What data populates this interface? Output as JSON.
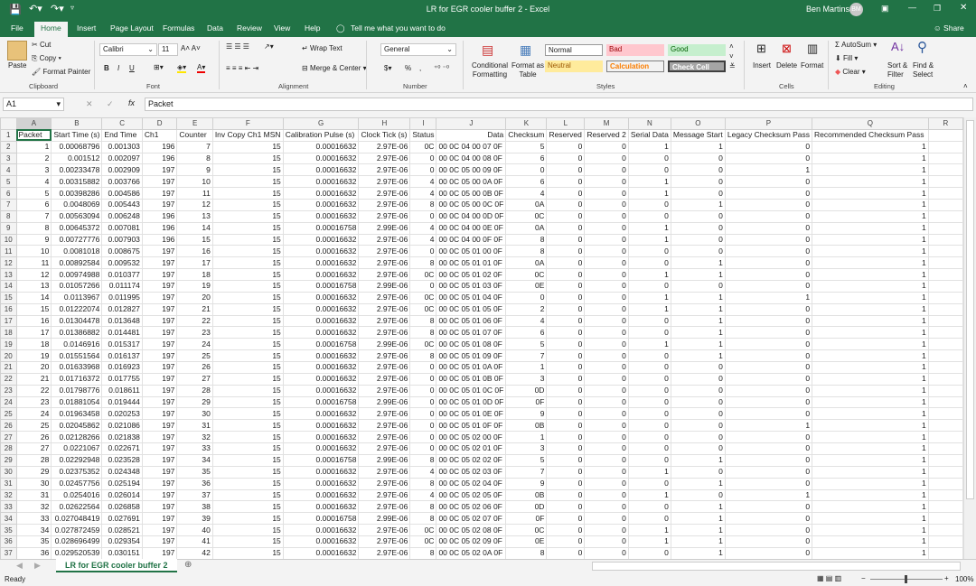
{
  "title": "LR for EGR cooler buffer 2  -  Excel",
  "user": {
    "name": "Ben Martins",
    "initials": "BM"
  },
  "share": "Share",
  "tabs": [
    "File",
    "Home",
    "Insert",
    "Page Layout",
    "Formulas",
    "Data",
    "Review",
    "View",
    "Help"
  ],
  "tell_me": "Tell me what you want to do",
  "ribbon": {
    "clipboard": {
      "paste": "Paste",
      "cut": "Cut",
      "copy": "Copy",
      "format_painter": "Format Painter",
      "label": "Clipboard"
    },
    "font": {
      "name": "Calibri",
      "size": "11",
      "bold": "B",
      "italic": "I",
      "underline": "U",
      "label": "Font"
    },
    "alignment": {
      "wrap": "Wrap Text",
      "merge": "Merge & Center",
      "label": "Alignment"
    },
    "number": {
      "format": "General",
      "percent": "%",
      "comma": ",",
      "label": "Number"
    },
    "styles": {
      "conditional": "Conditional Formatting",
      "format_table": "Format as Table",
      "normal": "Normal",
      "bad": "Bad",
      "good": "Good",
      "neutral": "Neutral",
      "calculation": "Calculation",
      "check": "Check Cell",
      "label": "Styles"
    },
    "cells": {
      "insert": "Insert",
      "delete": "Delete",
      "format": "Format",
      "label": "Cells"
    },
    "editing": {
      "autosum": "AutoSum",
      "fill": "Fill",
      "clear": "Clear",
      "sort": "Sort & Filter",
      "find": "Find & Select",
      "label": "Editing"
    }
  },
  "formula_bar": {
    "name_box": "A1",
    "content": "Packet"
  },
  "columns": [
    "A",
    "B",
    "C",
    "D",
    "E",
    "F",
    "G",
    "H",
    "I",
    "J",
    "K",
    "L",
    "M",
    "N",
    "O",
    "P",
    "Q",
    "R"
  ],
  "headers": [
    "Packet",
    "Start Time (s)",
    "End Time",
    "Ch1",
    "Counter",
    "Inv Copy Ch1 MSN",
    "Calibration Pulse (s)",
    "Clock Tick (s)",
    "Status",
    "Data",
    "Checksum",
    "Reserved",
    "Reserved 2",
    "Serial Data",
    "Message Start",
    "Legacy Checksum Pass",
    "Recommended Checksum Pass"
  ],
  "rows": [
    [
      "1",
      "0.00068796",
      "0.001303",
      "196",
      "7",
      "15",
      "0.00016632",
      "2.97E-06",
      "0C",
      "00 0C 04 00 07 0F",
      "5",
      "0",
      "0",
      "1",
      "1",
      "0",
      "1"
    ],
    [
      "2",
      "0.001512",
      "0.002097",
      "196",
      "8",
      "15",
      "0.00016632",
      "2.97E-06",
      "0",
      "00 0C 04 00 08 0F",
      "6",
      "0",
      "0",
      "0",
      "0",
      "0",
      "1"
    ],
    [
      "3",
      "0.00233478",
      "0.002909",
      "197",
      "9",
      "15",
      "0.00016632",
      "2.97E-06",
      "0",
      "00 0C 05 00 09 0F",
      "0",
      "0",
      "0",
      "0",
      "0",
      "1",
      "1"
    ],
    [
      "4",
      "0.00315882",
      "0.003766",
      "197",
      "10",
      "15",
      "0.00016632",
      "2.97E-06",
      "4",
      "00 0C 05 00 0A 0F",
      "6",
      "0",
      "0",
      "1",
      "0",
      "0",
      "1"
    ],
    [
      "5",
      "0.00398286",
      "0.004586",
      "197",
      "11",
      "15",
      "0.00016632",
      "2.97E-06",
      "4",
      "00 0C 05 00 0B 0F",
      "4",
      "0",
      "0",
      "1",
      "0",
      "0",
      "1"
    ],
    [
      "6",
      "0.0048069",
      "0.005443",
      "197",
      "12",
      "15",
      "0.00016632",
      "2.97E-06",
      "8",
      "00 0C 05 00 0C 0F",
      "0A",
      "0",
      "0",
      "0",
      "1",
      "0",
      "1"
    ],
    [
      "7",
      "0.00563094",
      "0.006248",
      "196",
      "13",
      "15",
      "0.00016632",
      "2.97E-06",
      "0",
      "00 0C 04 00 0D 0F",
      "0C",
      "0",
      "0",
      "0",
      "0",
      "0",
      "1"
    ],
    [
      "8",
      "0.00645372",
      "0.007081",
      "196",
      "14",
      "15",
      "0.00016758",
      "2.99E-06",
      "4",
      "00 0C 04 00 0E 0F",
      "0A",
      "0",
      "0",
      "1",
      "0",
      "0",
      "1"
    ],
    [
      "9",
      "0.00727776",
      "0.007903",
      "196",
      "15",
      "15",
      "0.00016632",
      "2.97E-06",
      "4",
      "00 0C 04 00 0F 0F",
      "8",
      "0",
      "0",
      "1",
      "0",
      "0",
      "1"
    ],
    [
      "10",
      "0.0081018",
      "0.008675",
      "197",
      "16",
      "15",
      "0.00016632",
      "2.97E-06",
      "0",
      "00 0C 05 01 00 0F",
      "8",
      "0",
      "0",
      "0",
      "0",
      "0",
      "1"
    ],
    [
      "11",
      "0.00892584",
      "0.009532",
      "197",
      "17",
      "15",
      "0.00016632",
      "2.97E-06",
      "8",
      "00 0C 05 01 01 0F",
      "0A",
      "0",
      "0",
      "0",
      "1",
      "0",
      "1"
    ],
    [
      "12",
      "0.00974988",
      "0.010377",
      "197",
      "18",
      "15",
      "0.00016632",
      "2.97E-06",
      "0C",
      "00 0C 05 01 02 0F",
      "0C",
      "0",
      "0",
      "1",
      "1",
      "0",
      "1"
    ],
    [
      "13",
      "0.01057266",
      "0.011174",
      "197",
      "19",
      "15",
      "0.00016758",
      "2.99E-06",
      "0",
      "00 0C 05 01 03 0F",
      "0E",
      "0",
      "0",
      "0",
      "0",
      "0",
      "1"
    ],
    [
      "14",
      "0.0113967",
      "0.011995",
      "197",
      "20",
      "15",
      "0.00016632",
      "2.97E-06",
      "0C",
      "00 0C 05 01 04 0F",
      "0",
      "0",
      "0",
      "1",
      "1",
      "1",
      "1"
    ],
    [
      "15",
      "0.01222074",
      "0.012827",
      "197",
      "21",
      "15",
      "0.00016632",
      "2.97E-06",
      "0C",
      "00 0C 05 01 05 0F",
      "2",
      "0",
      "0",
      "1",
      "1",
      "0",
      "1"
    ],
    [
      "16",
      "0.01304478",
      "0.013648",
      "197",
      "22",
      "15",
      "0.00016632",
      "2.97E-06",
      "8",
      "00 0C 05 01 06 0F",
      "4",
      "0",
      "0",
      "0",
      "1",
      "0",
      "1"
    ],
    [
      "17",
      "0.01386882",
      "0.014481",
      "197",
      "23",
      "15",
      "0.00016632",
      "2.97E-06",
      "8",
      "00 0C 05 01 07 0F",
      "6",
      "0",
      "0",
      "0",
      "1",
      "0",
      "1"
    ],
    [
      "18",
      "0.0146916",
      "0.015317",
      "197",
      "24",
      "15",
      "0.00016758",
      "2.99E-06",
      "0C",
      "00 0C 05 01 08 0F",
      "5",
      "0",
      "0",
      "1",
      "1",
      "0",
      "1"
    ],
    [
      "19",
      "0.01551564",
      "0.016137",
      "197",
      "25",
      "15",
      "0.00016632",
      "2.97E-06",
      "8",
      "00 0C 05 01 09 0F",
      "7",
      "0",
      "0",
      "0",
      "1",
      "0",
      "1"
    ],
    [
      "20",
      "0.01633968",
      "0.016923",
      "197",
      "26",
      "15",
      "0.00016632",
      "2.97E-06",
      "0",
      "00 0C 05 01 0A 0F",
      "1",
      "0",
      "0",
      "0",
      "0",
      "0",
      "1"
    ],
    [
      "21",
      "0.01716372",
      "0.017755",
      "197",
      "27",
      "15",
      "0.00016632",
      "2.97E-06",
      "0",
      "00 0C 05 01 0B 0F",
      "3",
      "0",
      "0",
      "0",
      "0",
      "0",
      "1"
    ],
    [
      "22",
      "0.01798776",
      "0.018611",
      "197",
      "28",
      "15",
      "0.00016632",
      "2.97E-06",
      "0",
      "00 0C 05 01 0C 0F",
      "0D",
      "0",
      "0",
      "0",
      "0",
      "0",
      "1"
    ],
    [
      "23",
      "0.01881054",
      "0.019444",
      "197",
      "29",
      "15",
      "0.00016758",
      "2.99E-06",
      "0",
      "00 0C 05 01 0D 0F",
      "0F",
      "0",
      "0",
      "0",
      "0",
      "0",
      "1"
    ],
    [
      "24",
      "0.01963458",
      "0.020253",
      "197",
      "30",
      "15",
      "0.00016632",
      "2.97E-06",
      "0",
      "00 0C 05 01 0E 0F",
      "9",
      "0",
      "0",
      "0",
      "0",
      "0",
      "1"
    ],
    [
      "25",
      "0.02045862",
      "0.021086",
      "197",
      "31",
      "15",
      "0.00016632",
      "2.97E-06",
      "0",
      "00 0C 05 01 0F 0F",
      "0B",
      "0",
      "0",
      "0",
      "0",
      "1",
      "1"
    ],
    [
      "26",
      "0.02128266",
      "0.021838",
      "197",
      "32",
      "15",
      "0.00016632",
      "2.97E-06",
      "0",
      "00 0C 05 02 00 0F",
      "1",
      "0",
      "0",
      "0",
      "0",
      "0",
      "1"
    ],
    [
      "27",
      "0.0221067",
      "0.022671",
      "197",
      "33",
      "15",
      "0.00016632",
      "2.97E-06",
      "0",
      "00 0C 05 02 01 0F",
      "3",
      "0",
      "0",
      "0",
      "0",
      "0",
      "1"
    ],
    [
      "28",
      "0.02292948",
      "0.023528",
      "197",
      "34",
      "15",
      "0.00016758",
      "2.99E-06",
      "8",
      "00 0C 05 02 02 0F",
      "5",
      "0",
      "0",
      "0",
      "1",
      "0",
      "1"
    ],
    [
      "29",
      "0.02375352",
      "0.024348",
      "197",
      "35",
      "15",
      "0.00016632",
      "2.97E-06",
      "4",
      "00 0C 05 02 03 0F",
      "7",
      "0",
      "0",
      "1",
      "0",
      "0",
      "1"
    ],
    [
      "30",
      "0.02457756",
      "0.025194",
      "197",
      "36",
      "15",
      "0.00016632",
      "2.97E-06",
      "8",
      "00 0C 05 02 04 0F",
      "9",
      "0",
      "0",
      "0",
      "1",
      "0",
      "1"
    ],
    [
      "31",
      "0.0254016",
      "0.026014",
      "197",
      "37",
      "15",
      "0.00016632",
      "2.97E-06",
      "4",
      "00 0C 05 02 05 0F",
      "0B",
      "0",
      "0",
      "1",
      "0",
      "1",
      "1"
    ],
    [
      "32",
      "0.02622564",
      "0.026858",
      "197",
      "38",
      "15",
      "0.00016632",
      "2.97E-06",
      "8",
      "00 0C 05 02 06 0F",
      "0D",
      "0",
      "0",
      "0",
      "1",
      "0",
      "1"
    ],
    [
      "33",
      "0.027048419",
      "0.027691",
      "197",
      "39",
      "15",
      "0.00016758",
      "2.99E-06",
      "8",
      "00 0C 05 02 07 0F",
      "0F",
      "0",
      "0",
      "0",
      "1",
      "0",
      "1"
    ],
    [
      "34",
      "0.027872459",
      "0.028521",
      "197",
      "40",
      "15",
      "0.00016632",
      "2.97E-06",
      "0C",
      "00 0C 05 02 08 0F",
      "0C",
      "0",
      "0",
      "1",
      "1",
      "0",
      "1"
    ],
    [
      "35",
      "0.028696499",
      "0.029354",
      "197",
      "41",
      "15",
      "0.00016632",
      "2.97E-06",
      "0C",
      "00 0C 05 02 09 0F",
      "0E",
      "0",
      "0",
      "1",
      "1",
      "0",
      "1"
    ],
    [
      "36",
      "0.029520539",
      "0.030151",
      "197",
      "42",
      "15",
      "0.00016632",
      "2.97E-06",
      "8",
      "00 0C 05 02 0A 0F",
      "8",
      "0",
      "0",
      "0",
      "1",
      "0",
      "1"
    ]
  ],
  "sheet_tab": "LR for EGR cooler buffer 2",
  "status": {
    "ready": "Ready",
    "zoom": "100%"
  },
  "colors": {
    "accent": "#217346"
  }
}
